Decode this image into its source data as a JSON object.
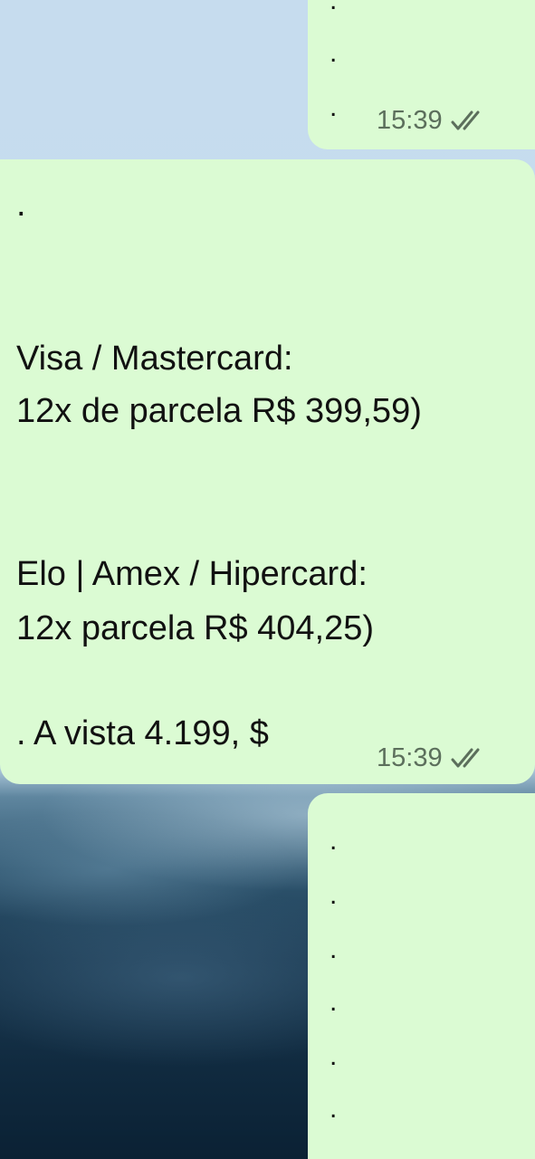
{
  "chat": {
    "messages": [
      {
        "time": "15:39",
        "status_icon": "double-check-icon",
        "lines": [
          ".",
          ".",
          "."
        ]
      },
      {
        "time": "15:39",
        "status_icon": "double-check-icon",
        "lines": [
          ".",
          "Visa / Mastercard:",
          "12x de parcela R$ 399,59)",
          "Elo | Amex / Hipercard:",
          "12x parcela R$ 404,25)",
          ". A vista 4.199, $"
        ]
      },
      {
        "lines": [
          ".",
          ".",
          ".",
          ".",
          ".",
          "."
        ]
      }
    ]
  },
  "colors": {
    "outgoing_bubble": "#dbfbd3",
    "meta_text": "#5c6f5c"
  }
}
